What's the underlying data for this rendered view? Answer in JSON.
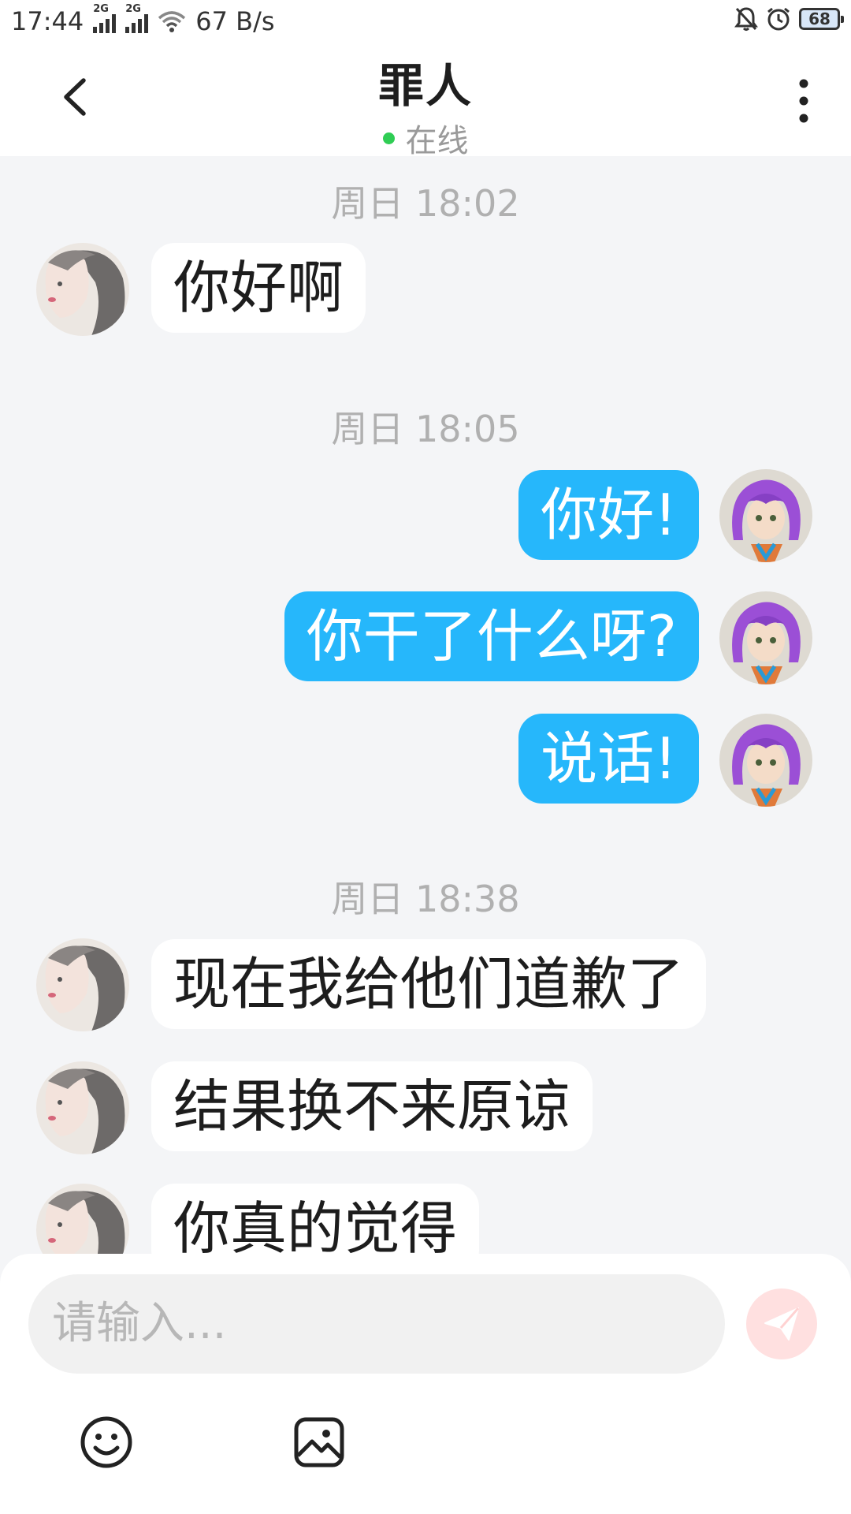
{
  "status_bar": {
    "time": "17:44",
    "sim1": "2G",
    "sim2": "2G",
    "net_speed": "67 B/s",
    "battery": "68",
    "icons": [
      "signal-icon",
      "wifi-icon",
      "mute-bell-icon",
      "alarm-icon",
      "battery-icon"
    ]
  },
  "header": {
    "title": "罪人",
    "presence": "在线",
    "presence_color": "#2fcd54",
    "back_icon": "chevron-left-icon",
    "menu_icon": "more-vertical-icon"
  },
  "chat": {
    "timestamps": [
      "周日 18:02",
      "周日 18:05",
      "周日 18:38"
    ],
    "messages": [
      {
        "from": "other",
        "text": "你好啊"
      },
      {
        "from": "me",
        "text": "你好!"
      },
      {
        "from": "me",
        "text": "你干了什么呀?"
      },
      {
        "from": "me",
        "text": "说话!"
      },
      {
        "from": "other",
        "text": "现在我给他们道歉了"
      },
      {
        "from": "other",
        "text": "结果换不来原谅"
      },
      {
        "from": "other",
        "text": "你真的觉得"
      }
    ],
    "outgoing_color": "#26b7fb",
    "incoming_color": "#ffffff"
  },
  "composer": {
    "placeholder": "请输入...",
    "send_icon": "send-icon",
    "emoji_icon": "smiley-icon",
    "image_icon": "image-icon"
  }
}
